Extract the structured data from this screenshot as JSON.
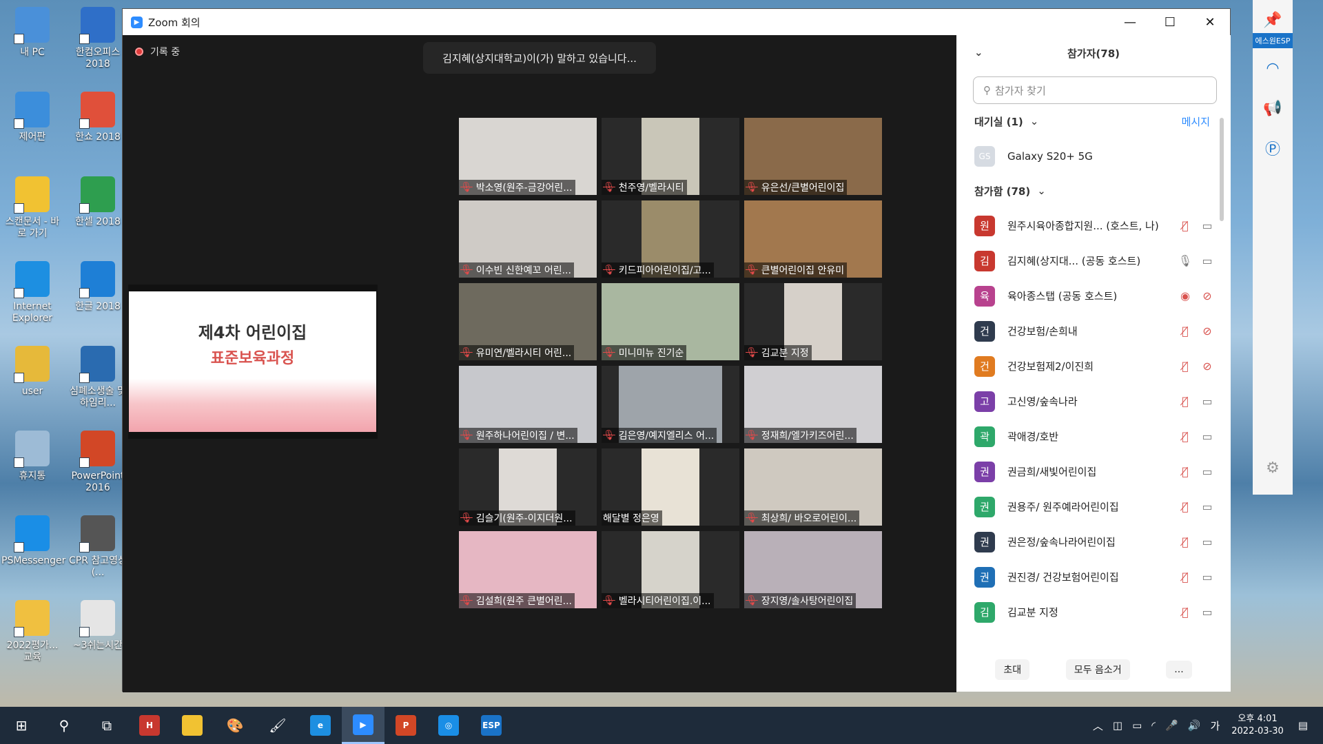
{
  "desktop": {
    "icons": [
      {
        "label": "내 PC",
        "icon": "pc-icon",
        "color": "#4a90d9"
      },
      {
        "label": "한컴오피스 2018",
        "icon": "hancom-office-icon",
        "color": "#2f6fc8"
      },
      {
        "label": "제어판",
        "icon": "control-panel-icon",
        "color": "#3c8edb"
      },
      {
        "label": "한쇼 2018",
        "icon": "hanshow-icon",
        "color": "#e0503a"
      },
      {
        "label": "스캔문서 - 바로 가기",
        "icon": "folder-icon",
        "color": "#f1c232"
      },
      {
        "label": "한셀 2018",
        "icon": "hancell-icon",
        "color": "#2e9e4f"
      },
      {
        "label": "Internet Explorer",
        "icon": "ie-icon",
        "color": "#1d8fe1"
      },
      {
        "label": "한글 2018",
        "icon": "hangul-icon",
        "color": "#1e7fd6"
      },
      {
        "label": "user",
        "icon": "user-folder-icon",
        "color": "#e6b93a"
      },
      {
        "label": "심폐소생술 및 하임리...",
        "icon": "image-file-icon",
        "color": "#2a6bb0"
      },
      {
        "label": "휴지통",
        "icon": "recycle-bin-icon",
        "color": "#9dbbd6"
      },
      {
        "label": "PowerPoint 2016",
        "icon": "powerpoint-icon",
        "color": "#d24726"
      },
      {
        "label": "PSMessenger",
        "icon": "psmessenger-icon",
        "color": "#1a8ee6"
      },
      {
        "label": "CPR 참고영상(...",
        "icon": "video-file-icon",
        "color": "#555"
      },
      {
        "label": "2022평가... 교육",
        "icon": "pdf-file-icon",
        "color": "#f0c040"
      },
      {
        "label": "~3쉬는시간",
        "icon": "pptx-file-icon",
        "color": "#e5e5e5"
      }
    ]
  },
  "zoom": {
    "title": "Zoom 회의",
    "recording": "기록 중",
    "speaking": "김지혜(상지대학교)이(가) 말하고 있습니다...",
    "slide": {
      "title1": "제4차 어린이집",
      "title2": "표준보육과정"
    },
    "tiles": [
      "박소영(원주-금강어린...",
      "천주영/벨라시티",
      "유은선/큰별어린이집",
      "이수빈 신한예꼬 어린...",
      "키드피아어린이집/고...",
      "큰별어린이집 안유미",
      "유미연/벨라시티 어린...",
      "미니미뉴 진기순",
      "김교분 지정",
      "원주하나어린이집 / 변...",
      "김은영/예지엘리스 어...",
      "정재희/엘가키즈어린...",
      "김슬기(원주-이지더원...",
      "해달별 정은영",
      "최상희/ 바오로어린이...",
      "김설희(원주 큰별어린...",
      "벨라시티어린이집.이...",
      "장지영/솔사탕어린이집"
    ],
    "tile_colors": [
      "#d9d6d2",
      "#c9c6b8",
      "#8a6a4a",
      "#cfcbc6",
      "#9b8c6a",
      "#a2784e",
      "#6e6a5e",
      "#a9b7a0",
      "#d6d0c9",
      "#c7c8cc",
      "#9ea4aa",
      "#d0cfd2",
      "#dedad6",
      "#e8e2d6",
      "#cfc9c0",
      "#e6b7c3",
      "#d6d3cb",
      "#b9b0b8"
    ],
    "tile_muted": [
      true,
      true,
      true,
      true,
      true,
      true,
      true,
      true,
      true,
      true,
      true,
      true,
      true,
      false,
      true,
      true,
      true,
      true
    ]
  },
  "panel": {
    "header": "참가자(78)",
    "search_placeholder": "참가자 찾기",
    "waiting": "대기실 (1)",
    "message": "메시지",
    "waiting_user": {
      "name": "Galaxy S20+ 5G",
      "initials": "GS"
    },
    "joined": "참가함 (78)",
    "participants": [
      {
        "initial": "원",
        "name": "원주시육아종합지원... (호스트, 나)",
        "color": "#c8382f",
        "mic": "muted",
        "cam": "on"
      },
      {
        "initial": "김",
        "name": "김지혜(상지대... (공동 호스트)",
        "color": "#c8382f",
        "mic": "on",
        "cam": "on"
      },
      {
        "initial": "육",
        "name": "육아종스탭 (공동 호스트)",
        "color": "#b8428e",
        "mic": "rec",
        "cam": "off"
      },
      {
        "initial": "건",
        "name": "건강보험/손희내",
        "color": "#2f3b4e",
        "mic": "muted",
        "cam": "off"
      },
      {
        "initial": "건",
        "name": "건강보험제2/이진희",
        "color": "#e07b20",
        "mic": "muted",
        "cam": "off"
      },
      {
        "initial": "고",
        "name": "고신영/숲속나라",
        "color": "#7b3fa8",
        "mic": "muted",
        "cam": "on"
      },
      {
        "initial": "곽",
        "name": "곽애경/호반",
        "color": "#2ea86a",
        "mic": "muted",
        "cam": "on"
      },
      {
        "initial": "권",
        "name": "권금희/새빛어린이집",
        "color": "#7b3fa8",
        "mic": "muted",
        "cam": "on"
      },
      {
        "initial": "권",
        "name": "권용주/ 원주예라어린이집",
        "color": "#2ea86a",
        "mic": "muted",
        "cam": "on"
      },
      {
        "initial": "권",
        "name": "권은정/숲속나라어린이집",
        "color": "#2f3b4e",
        "mic": "muted",
        "cam": "on"
      },
      {
        "initial": "권",
        "name": "권진경/ 건강보험어린이집",
        "color": "#1f6fb5",
        "mic": "muted",
        "cam": "on"
      },
      {
        "initial": "김",
        "name": "김교분 지정",
        "color": "#2ea86a",
        "mic": "muted",
        "cam": "on"
      }
    ],
    "invite": "초대",
    "mute_all": "모두 음소거",
    "more": "..."
  },
  "sidebar": {
    "label": "에스원ESP"
  },
  "taskbar": {
    "time": "오후 4:01",
    "date": "2022-03-30",
    "ime": "가"
  }
}
